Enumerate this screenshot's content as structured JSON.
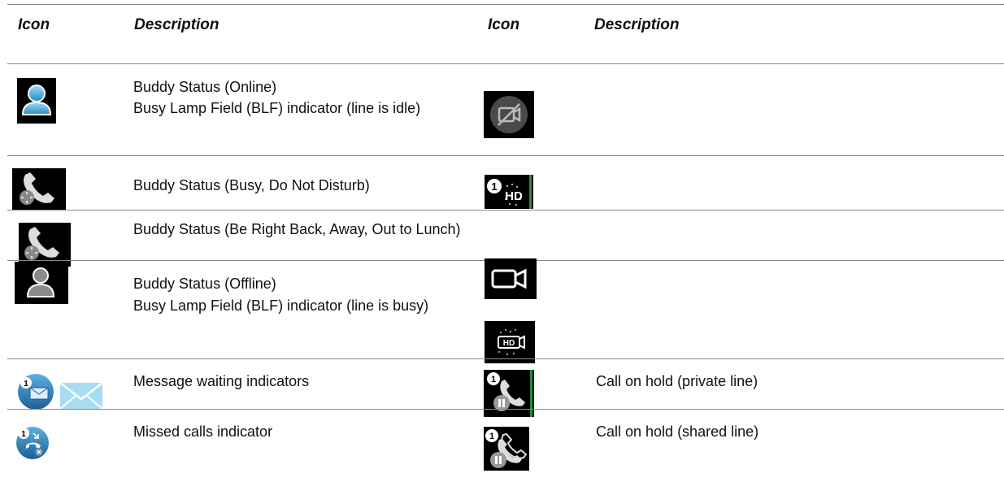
{
  "headers": {
    "icon_left": "Icon",
    "desc_left": "Description",
    "icon_right": "Icon",
    "desc_right": "Description"
  },
  "rows": [
    {
      "left_icon": "buddy-online-icon",
      "left_lines": [
        "Buddy Status (Online)",
        "Busy Lamp Field (BLF) indicator (line is idle)"
      ],
      "right_icon": "video-off-icon",
      "right_text": ""
    },
    {
      "left_icon": "handset-busy-icon",
      "left_lines": [
        "Buddy Status (Busy, Do Not Disturb)"
      ],
      "right_icon": "hd-audio-icon",
      "right_text": ""
    },
    {
      "left_icon": "handset-away-icon",
      "left_lines": [
        "Buddy Status (Be Right Back, Away, Out to Lunch)"
      ],
      "right_icon": "",
      "right_text": ""
    },
    {
      "left_icon": "buddy-offline-icon",
      "left_lines": [
        "Buddy Status (Offline)",
        "Busy Lamp Field (BLF) indicator (line is busy)"
      ],
      "right_icon": "video-camera-icon",
      "right_text": ""
    },
    {
      "left_icon": "",
      "left_lines": [],
      "right_icon": "hd-video-icon",
      "right_text": ""
    },
    {
      "left_icon": "message-waiting-icon",
      "left_lines": [
        "Message waiting indicators"
      ],
      "right_icon": "hold-private-icon",
      "right_text": "Call on hold (private line)"
    },
    {
      "left_icon": "missed-call-icon",
      "left_lines": [
        "Missed calls indicator"
      ],
      "right_icon": "hold-shared-icon",
      "right_text": "Call on hold (shared line)"
    }
  ]
}
